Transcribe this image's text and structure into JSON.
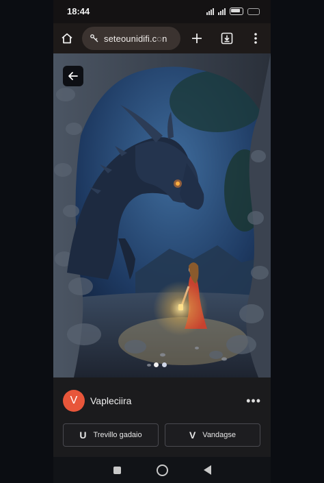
{
  "status": {
    "time": "18:44"
  },
  "browser": {
    "url": "seteounidifi.c◌n"
  },
  "hero": {
    "alt": "dragon in cave with girl holding lantern",
    "page_count": 2,
    "active_index": 0
  },
  "post": {
    "avatar_initial": "V",
    "avatar_color": "#e8563a",
    "name": "Vapleciira",
    "more_label": "•••"
  },
  "actions": [
    {
      "icon": "U",
      "label": "Trevillo gadaio"
    },
    {
      "icon": "V",
      "label": "Vandagse"
    }
  ]
}
